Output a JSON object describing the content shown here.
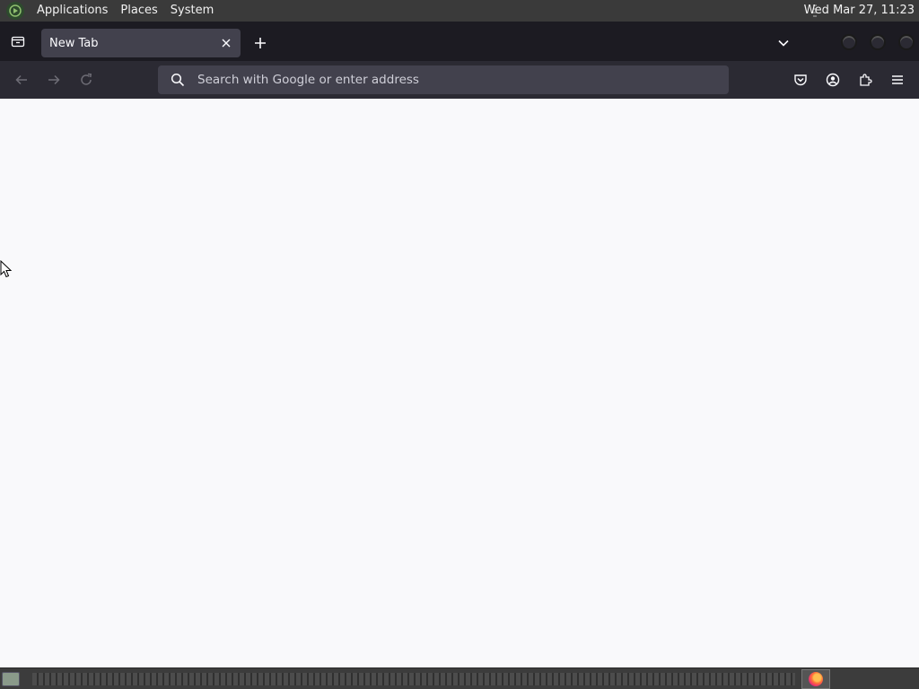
{
  "topbar": {
    "menus": [
      "Applications",
      "Places",
      "System"
    ],
    "clock": "Wed Mar 27, 11:23"
  },
  "tabs": [
    {
      "label": "New Tab"
    }
  ],
  "urlbar": {
    "placeholder": "Search with Google or enter address",
    "value": ""
  },
  "icons": {
    "menu_logo": "mate-menu-icon",
    "tab_list": "tab-list-icon",
    "close": "close-icon",
    "new_tab": "plus-icon",
    "overflow": "chevron-down-icon",
    "back": "back-arrow-icon",
    "forward": "forward-arrow-icon",
    "reload": "reload-icon",
    "search": "search-icon",
    "pocket": "pocket-icon",
    "account": "account-icon",
    "extensions": "extensions-icon",
    "app_menu": "hamburger-menu-icon"
  },
  "colors": {
    "topbar_bg": "#3a3a3a",
    "tabstrip_bg": "#1c1b22",
    "toolbar_bg": "#2b2a33",
    "urlbar_bg": "#42414d",
    "content_bg": "#f9f9fb"
  }
}
